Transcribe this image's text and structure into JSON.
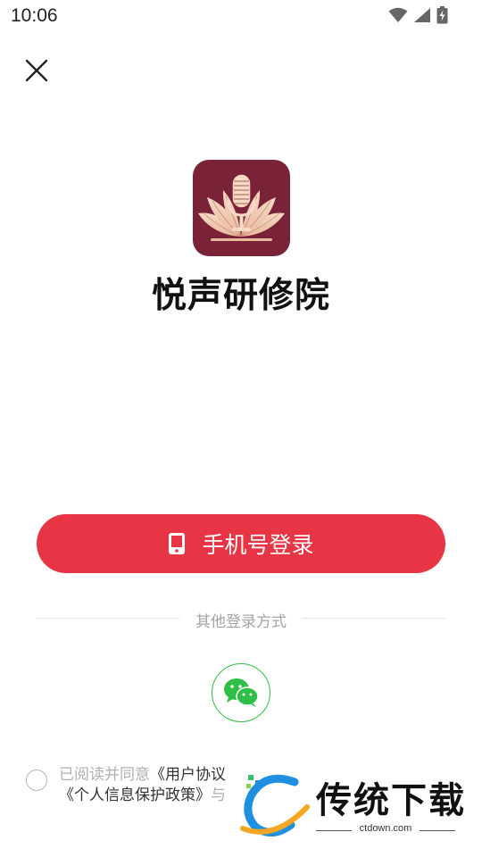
{
  "status_bar": {
    "time": "10:06"
  },
  "app": {
    "name": "悦声研修院"
  },
  "login": {
    "phone_button_label": "手机号登录"
  },
  "other_methods": {
    "divider_label": "其他登录方式"
  },
  "agreement": {
    "prefix": "已阅读并同意",
    "user_agreement": "《用户协议",
    "privacy_policy": "《个人信息保护政策》",
    "suffix": "与"
  },
  "watermark": {
    "text": "传统下载",
    "url": "ctdown.com"
  },
  "colors": {
    "primary": "#e83545",
    "logo_bg": "#7a2238",
    "wechat": "#2fbf46"
  }
}
